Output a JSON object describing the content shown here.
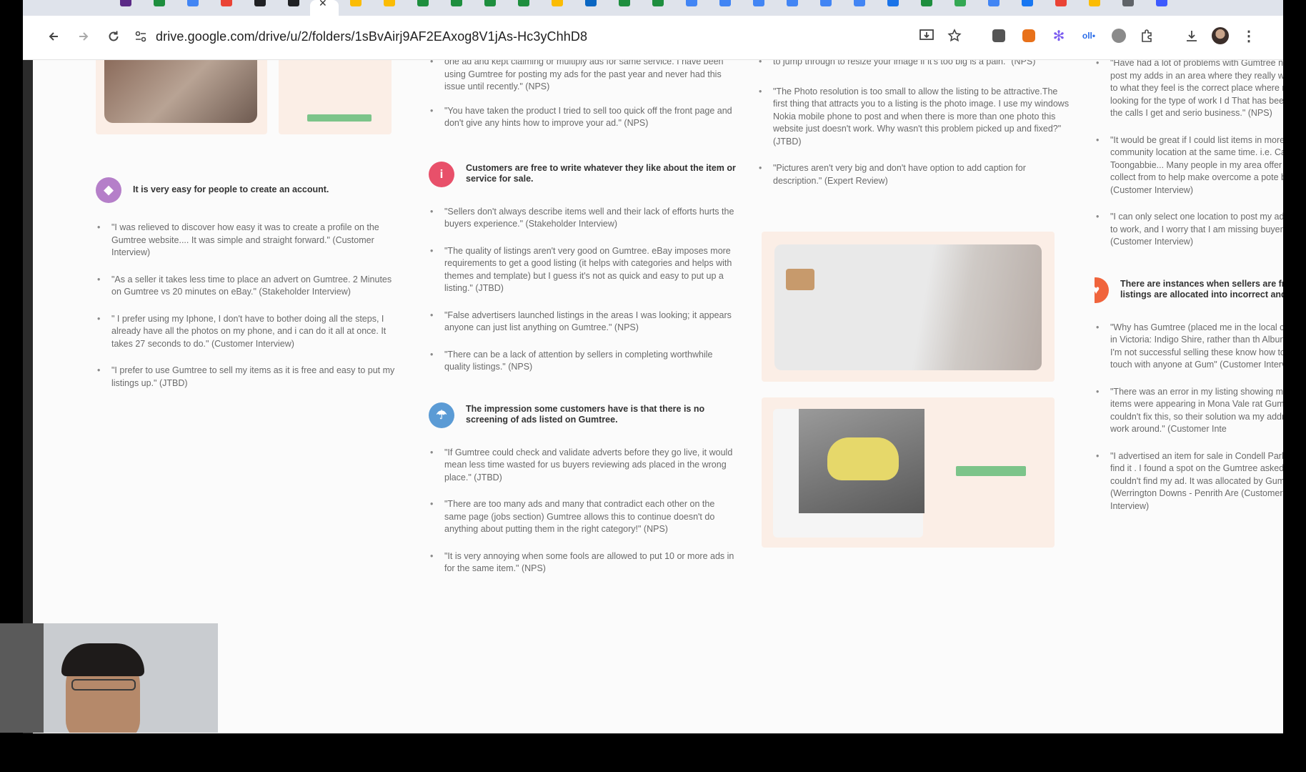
{
  "browser": {
    "active_tab_close": "✕",
    "url": "drive.google.com/drive/u/2/folders/1sBvAirj9AF2EAxog8V1jAs-Hc3yChhD8",
    "tab_colors": [
      "#5b2a86",
      "#1e8e3e",
      "#4285f4",
      "#ea4335",
      "#202124",
      "#202124",
      "#ffffff",
      "#fbbc04",
      "#fbbc04",
      "#1e8e3e",
      "#1e8e3e",
      "#1e8e3e",
      "#1e8e3e",
      "#fbbc04",
      "#0a66c2",
      "#1e8e3e",
      "#1e8e3e",
      "#4285f4",
      "#4285f4",
      "#4285f4",
      "#4285f4",
      "#4285f4",
      "#4285f4",
      "#1a73e8",
      "#1e8e3e",
      "#34a853",
      "#4285f4",
      "#1877f2",
      "#ea4335",
      "#fbbc04",
      "#5f6368",
      "#3d5afe"
    ]
  },
  "col1": {
    "theme1": "It is very easy for people to create an account.",
    "quotes": [
      "\"I was relieved to discover how easy it was to create a profile on the Gumtree website.... It was simple and straight forward.\" (Customer Interview)",
      "\"As a seller it takes less time to place an advert on Gumtree. 2 Minutes on Gumtree vs 20 minutes on eBay.\" (Stakeholder Interview)",
      "\" I prefer using my Iphone, I don't have to bother doing all the steps, I already have all the photos on my phone, and i can do it all at once. It takes 27 seconds to do.\" (Customer Interview)",
      "\"I prefer to use Gumtree to sell my items as it is free and easy to put my listings up.\" (JTBD)"
    ]
  },
  "col2": {
    "top_quotes": [
      "one ad and kept claiming or multiply ads for same service. I have been using Gumtree for posting my ads for the past year and never had this issue until recently.\" (NPS)",
      "\"You have taken the product I tried to sell too quick off the front page and don't give any hints how to improve your ad.\" (NPS)"
    ],
    "theme2": "Customers are free to write whatever they like about the item or service for sale.",
    "theme2_quotes": [
      "\"Sellers don't always describe items well and their lack of efforts hurts the buyers experience.\" (Stakeholder Interview)",
      "\"The quality of listings aren't very good on Gumtree. eBay imposes more requirements to get a good listing (it helps with categories and helps with themes and template) but I guess it's not as quick and easy to put up a listing.\" (JTBD)",
      "\"False advertisers launched listings in the areas I was looking; it appears anyone can just list anything on Gumtree.\" (NPS)",
      "\"There can be a lack of attention by sellers in completing worthwhile quality listings.\" (NPS)"
    ],
    "theme3": "The impression some customers have is that there is no screening of ads listed on Gumtree.",
    "theme3_quotes": [
      "\"If Gumtree could check and validate adverts before they go live, it would mean less time wasted for us buyers reviewing ads placed in the wrong place.\" (JTBD)",
      "\"There are too many ads and many that contradict each other on the same page (jobs section) Gumtree allows this to continue doesn't do anything about putting them in the right category!\" (NPS)",
      "\"It is very annoying when some fools are allowed to put 10 or more ads in for the same item.\" (NPS)"
    ]
  },
  "col3": {
    "top_quote_tail": "to jump through to resize your image if it's too big is a pain.\" (NPS)",
    "quotes": [
      "\"The Photo resolution is too small to allow the listing to be attractive.The first thing that attracts you to a listing is the photo image. I use my windows Nokia mobile phone to post and when there is more than one photo this website just doesn't work. Why wasn't this problem picked up and fixed?\" (JTBD)",
      "\"Pictures aren't very big and don't have option to add caption for description.\" (Expert Review)"
    ]
  },
  "col4": {
    "top_quotes": [
      "\"Have had a lot of problems with Gumtree now to post my adds in an area where they really w remove to what they feel is the correct place where nobody looking for the type of work I d That has been halving the calls I get and serio business.\" (NPS)",
      "\"It would be great if I could list items in more community location at the same time. i.e. Cam Toongabbie... Many people in my area offer all to collect from to help make overcome a pote buyers.\" (Customer Interview)",
      "\"I can only select one location to post my ad. my item to work, and I worry that I am missing buyers.\" (Customer Interview)"
    ],
    "theme4": "There are instances when sellers are frus listings are allocated into incorrect and i",
    "theme4_quotes": [
      "\"Why has Gumtree (placed me in the local co border in Victoria: Indigo Shire, rather than th Albury region. I'm not successful selling these know how to get in touch with anyone at Gum\" (Customer Interview)",
      "\"There was an error in my listing showing my so my items were appearing in Mona Vale rat Gumtree couldn't fix this, so their solution wa my address as a work around.\" (Customer Inte",
      "\"I advertised an item for sale in Condell Park. couldn't find it . I found a spot on the Gumtree asked if I couldn't find my ad. It was allocated by Gumtree (Werrington Downs - Penrith Are (Customer Interview)"
    ]
  },
  "colors": {
    "theme1_icon": "#b57fc9",
    "theme2_icon": "#e8506a",
    "theme3_icon": "#5b9bd5",
    "theme4_icon": "#f0643c"
  }
}
